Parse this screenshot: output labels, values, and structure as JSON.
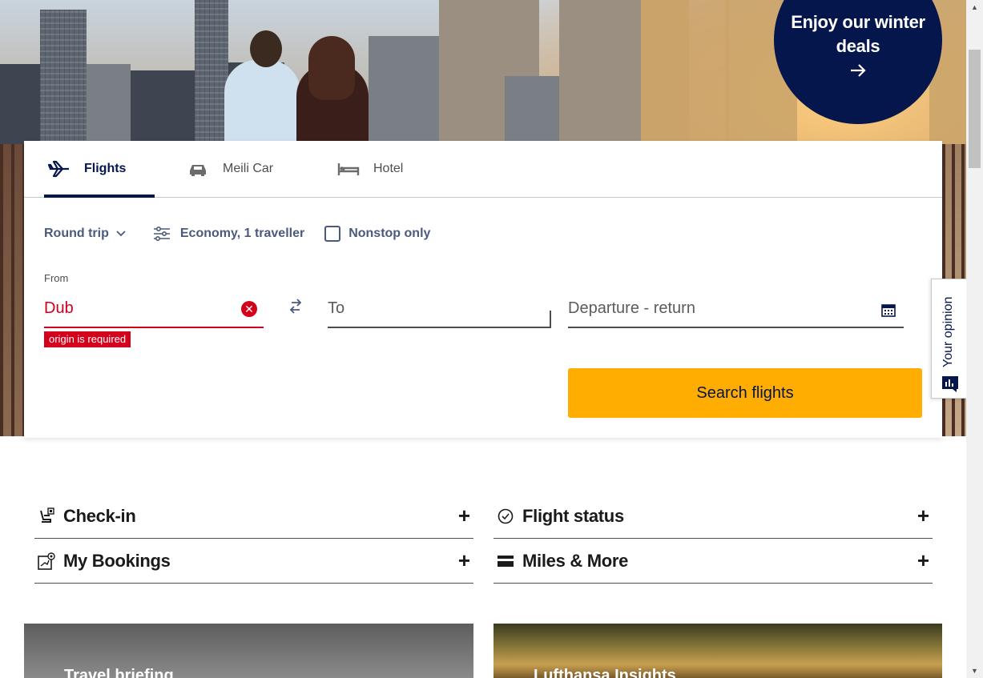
{
  "promo": {
    "text": "Enjoy our winter deals",
    "arrow_icon": "arrow-right-icon"
  },
  "tabs": [
    {
      "label": "Flights",
      "icon": "airplane-icon",
      "active": true
    },
    {
      "label": "Meili Car",
      "icon": "car-icon",
      "active": false
    },
    {
      "label": "Hotel",
      "icon": "bed-icon",
      "active": false
    }
  ],
  "options": {
    "trip_type": "Round trip",
    "cabin": "Economy, 1 traveller",
    "nonstop_label": "Nonstop only",
    "nonstop_checked": false
  },
  "search": {
    "from_label": "From",
    "from_value": "Dub",
    "from_error": "origin is required",
    "to_placeholder": "To",
    "dates_placeholder": "Departure - return",
    "button": "Search flights"
  },
  "feedback_tab": {
    "label": "Your opinion"
  },
  "quick_links": [
    {
      "label": "Check-in",
      "icon": "checkin-seat-icon"
    },
    {
      "label": "Flight status",
      "icon": "clock-icon"
    },
    {
      "label": "My Bookings",
      "icon": "booking-icon"
    },
    {
      "label": "Miles & More",
      "icon": "card-icon"
    }
  ],
  "teasers": [
    {
      "title": "Travel briefing"
    },
    {
      "title": "Lufthansa Insights"
    }
  ],
  "colors": {
    "brand_navy": "#05164d",
    "accent_yellow": "#ffad00",
    "error_red": "#d4001b"
  }
}
